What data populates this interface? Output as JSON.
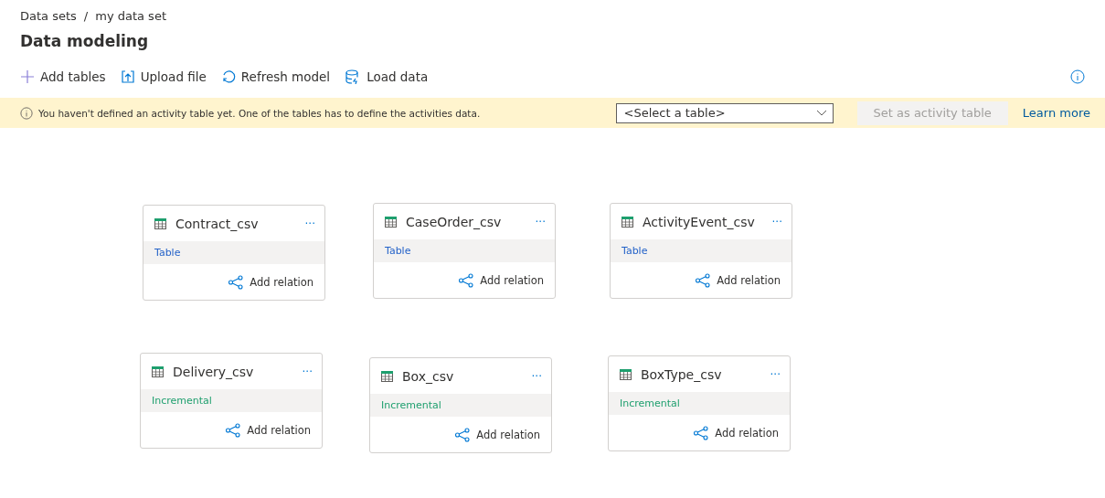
{
  "breadcrumb": [
    "Data sets",
    "/",
    "my data set"
  ],
  "title": "Data modeling",
  "toolbar": [
    {
      "kind": "add",
      "label": "Add tables"
    },
    {
      "kind": "upload",
      "label": "Upload file"
    },
    {
      "kind": "refresh",
      "label": "Refresh model"
    },
    {
      "kind": "load",
      "label": "Load data"
    }
  ],
  "banner": {
    "message": "You haven't defined an activity table yet. One of the tables has to define the activities data.",
    "select": {
      "value": "<Select a table>"
    },
    "button": {
      "label": "Set as activity table",
      "disabled": true
    },
    "link": "Learn more"
  },
  "tables": [
    {
      "name": "Contract_csv",
      "more": "···",
      "kind": "table",
      "type": "Table",
      "action": "Add relation"
    },
    {
      "name": "CaseOrder_csv",
      "more": "···",
      "kind": "table",
      "type": "Table",
      "action": "Add relation"
    },
    {
      "name": "ActivityEvent_csv",
      "more": "···",
      "kind": "table",
      "type": "Table",
      "action": "Add relation"
    },
    {
      "name": "Delivery_csv",
      "more": "···",
      "kind": "incremental",
      "type": "Incremental",
      "action": "Add relation"
    },
    {
      "name": "Box_csv",
      "more": "···",
      "kind": "incremental",
      "type": "Incremental",
      "action": "Add relation"
    },
    {
      "name": "BoxType_csv",
      "more": "···",
      "kind": "incremental",
      "type": "Incremental",
      "action": "Add relation"
    }
  ]
}
